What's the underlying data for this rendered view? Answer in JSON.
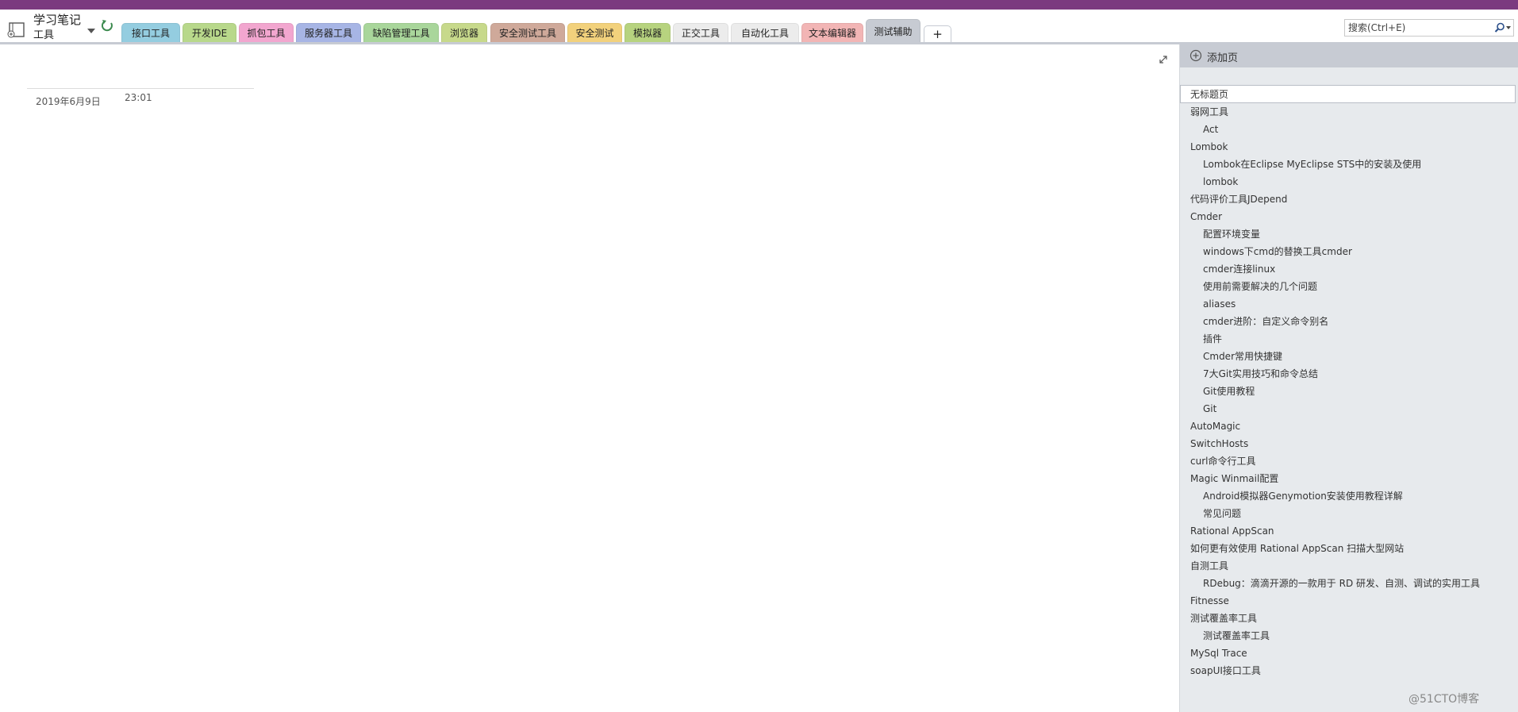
{
  "notebook": {
    "title": "学习笔记",
    "section": "工具"
  },
  "tabs": [
    {
      "label": "接口工具",
      "color": "#94cde0"
    },
    {
      "label": "开发IDE",
      "color": "#b8d88b"
    },
    {
      "label": "抓包工具",
      "color": "#f2a6cf"
    },
    {
      "label": "服务器工具",
      "color": "#a7b5e5"
    },
    {
      "label": "缺陷管理工具",
      "color": "#a9d69b"
    },
    {
      "label": "浏览器",
      "color": "#c7d98b"
    },
    {
      "label": "安全测试工具",
      "color": "#cfa99a"
    },
    {
      "label": "安全测试",
      "color": "#f2d17c"
    },
    {
      "label": "模拟器",
      "color": "#b7d37f"
    },
    {
      "label": "正交工具",
      "color": "#ececec"
    },
    {
      "label": "自动化工具",
      "color": "#ececec"
    },
    {
      "label": "文本编辑器",
      "color": "#f2b5b5"
    },
    {
      "label": "测试辅助",
      "color": "#c7cbd3",
      "active": true
    },
    {
      "label": "+",
      "color": "#ffffff"
    }
  ],
  "search": {
    "placeholder": "搜索(Ctrl+E)"
  },
  "page": {
    "date": "2019年6月9日",
    "time": "23:01"
  },
  "panel": {
    "add_page_label": "添加页",
    "untitled_placeholder": "无标题页",
    "pages": [
      {
        "label": "弱网工具",
        "level": 1
      },
      {
        "label": "Act",
        "level": 2
      },
      {
        "label": "Lombok",
        "level": 1
      },
      {
        "label": "Lombok在Eclipse MyEclipse STS中的安装及使用",
        "level": 2
      },
      {
        "label": "lombok",
        "level": 2
      },
      {
        "label": "代码评价工具JDepend",
        "level": 1
      },
      {
        "label": "Cmder",
        "level": 1
      },
      {
        "label": "配置环境变量",
        "level": 2
      },
      {
        "label": "windows下cmd的替换工具cmder",
        "level": 2
      },
      {
        "label": "cmder连接linux",
        "level": 2
      },
      {
        "label": "使用前需要解决的几个问题",
        "level": 2
      },
      {
        "label": "aliases",
        "level": 2
      },
      {
        "label": "cmder进阶：自定义命令别名",
        "level": 2
      },
      {
        "label": "插件",
        "level": 2
      },
      {
        "label": "Cmder常用快捷键",
        "level": 2
      },
      {
        "label": "7大Git实用技巧和命令总结",
        "level": 2
      },
      {
        "label": "Git使用教程",
        "level": 2
      },
      {
        "label": "Git",
        "level": 2
      },
      {
        "label": "AutoMagic",
        "level": 1
      },
      {
        "label": "SwitchHosts",
        "level": 1
      },
      {
        "label": "curl命令行工具",
        "level": 1
      },
      {
        "label": "Magic Winmail配置",
        "level": 1
      },
      {
        "label": "Android模拟器Genymotion安装使用教程详解",
        "level": 2
      },
      {
        "label": "常见问题",
        "level": 2
      },
      {
        "label": "Rational AppScan",
        "level": 1
      },
      {
        "label": "如何更有效使用 Rational AppScan 扫描大型网站",
        "level": 1
      },
      {
        "label": "自测工具",
        "level": 1
      },
      {
        "label": "RDebug：滴滴开源的一款用于 RD 研发、自测、调试的实用工具",
        "level": 2
      },
      {
        "label": "Fitnesse",
        "level": 1
      },
      {
        "label": "测试覆盖率工具",
        "level": 1
      },
      {
        "label": "测试覆盖率工具",
        "level": 2
      },
      {
        "label": "MySql Trace",
        "level": 1
      },
      {
        "label": "soapUI接口工具",
        "level": 1
      }
    ]
  },
  "watermark": "@51CTO博客",
  "colors": {
    "title_bar": "#7b3a7f",
    "panel_bg": "#e7eaed",
    "active_tab": "#c7cbd3"
  }
}
